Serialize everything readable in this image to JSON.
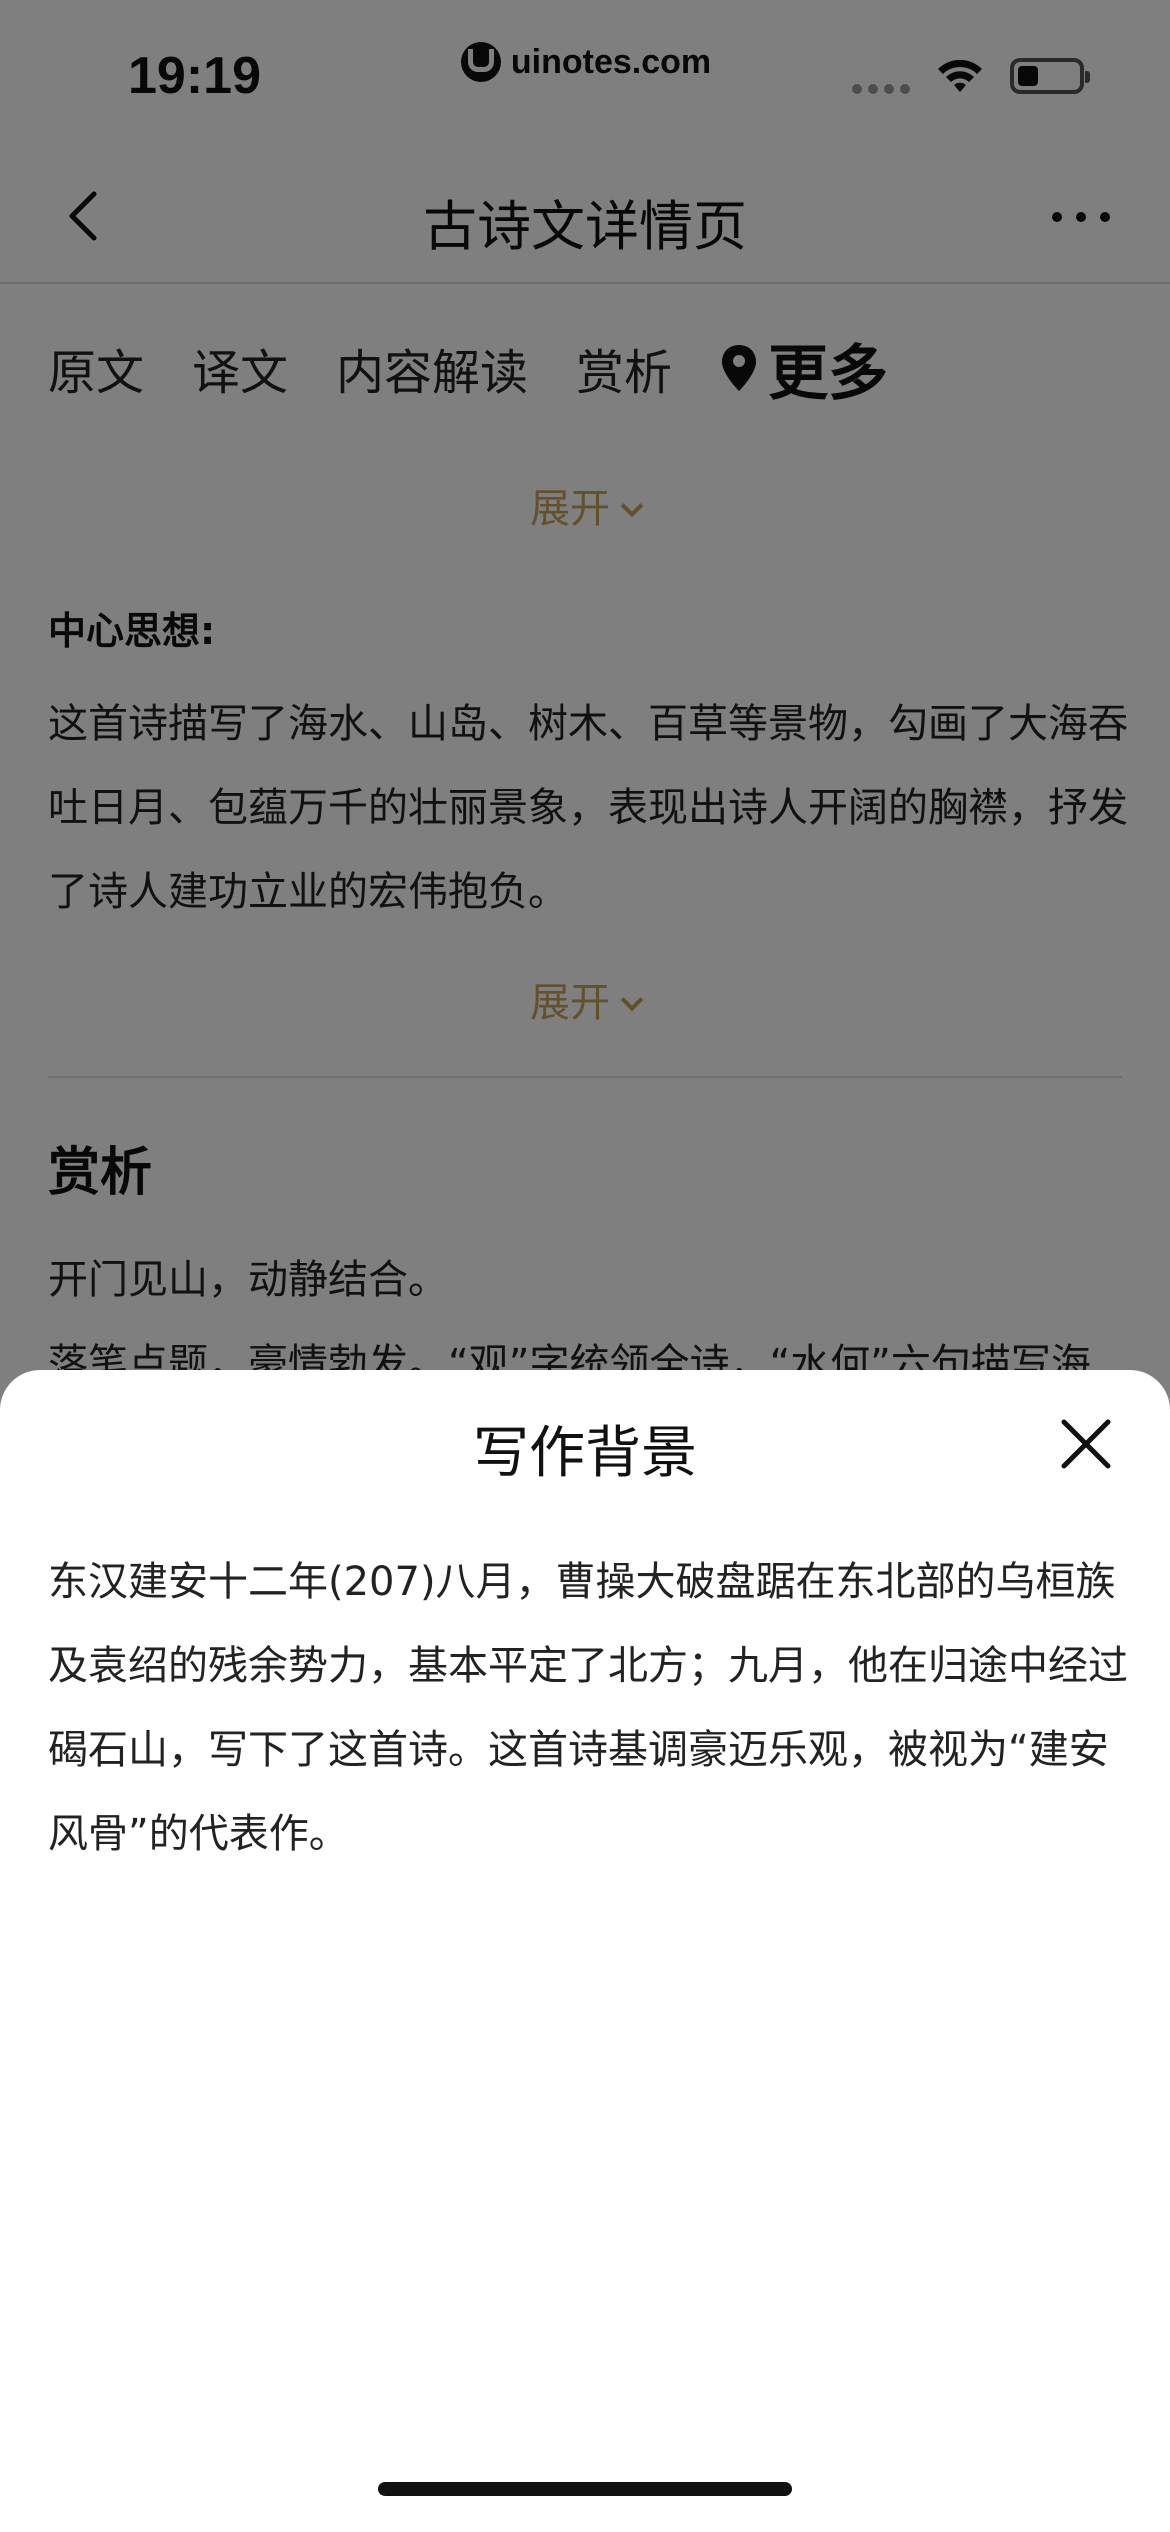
{
  "status_bar": {
    "time": "19:19",
    "url": "uinotes.com",
    "battery_level": 0.35
  },
  "nav": {
    "title": "古诗文详情页",
    "back_icon": "chevron-left-icon",
    "more_icon": "more-horizontal-icon"
  },
  "tabs": [
    {
      "label": "原文"
    },
    {
      "label": "译文"
    },
    {
      "label": "内容解读"
    },
    {
      "label": "赏析"
    },
    {
      "label": "更多",
      "icon": "location-pin-icon",
      "active": true
    }
  ],
  "content": {
    "expand_label_1": "展开",
    "central_idea_label": "中心思想:",
    "central_idea_text": "这首诗描写了海水、山岛、树木、百草等景物，勾画了大海吞吐日月、包蕴万千的壮丽景象，表现出诗人开阔的胸襟，抒发了诗人建功立业的宏伟抱负。",
    "expand_label_2": "展开",
    "appreciation_title": "赏析",
    "appreciation_line_1": "开门见山，动静结合。",
    "appreciation_line_2": "落笔点题，豪情勃发。“观”字统领全诗，“水何”六句描写海"
  },
  "sheet": {
    "title": "写作背景",
    "close_icon": "close-icon",
    "text": "东汉建安十二年(207)八月，曹操大破盘踞在东北部的乌桓族及袁绍的残余势力，基本平定了北方；九月，他在归途中经过碣石山，写下了这首诗。这首诗基调豪迈乐观，被视为“建安风骨”的代表作。"
  },
  "colors": {
    "accent": "#c6a15a",
    "overlay": "rgba(0,0,0,0.5)"
  }
}
